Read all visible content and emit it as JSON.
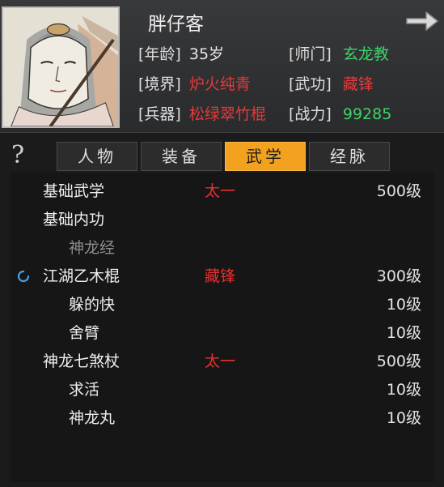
{
  "character": {
    "name": "胖仔客",
    "fields": {
      "age": {
        "label": "[年龄]",
        "value": "35岁",
        "color": "#e6e6e6"
      },
      "sect": {
        "label": "[师门]",
        "value": "玄龙教",
        "color": "#3fd36a"
      },
      "realm": {
        "label": "[境界]",
        "value": "炉火纯青",
        "color": "#e33a3a"
      },
      "martial": {
        "label": "[武功]",
        "value": "藏锋",
        "color": "#e33a3a"
      },
      "weapon": {
        "label": "[兵器]",
        "value": "松绿翠竹棍",
        "color": "#e33a3a"
      },
      "power": {
        "label": "[战力]",
        "value": "99285",
        "color": "#3fd36a"
      }
    }
  },
  "tabs": [
    {
      "label": "人物",
      "active": false
    },
    {
      "label": "装备",
      "active": false
    },
    {
      "label": "武学",
      "active": true
    },
    {
      "label": "经脉",
      "active": false
    }
  ],
  "help_glyph": "?",
  "skills": [
    {
      "name": "基础武学",
      "school": "太一",
      "level": "500级",
      "indent": 0
    },
    {
      "name": "基础内功",
      "school": "",
      "level": "",
      "indent": 0
    },
    {
      "name": "神龙经",
      "school": "",
      "level": "",
      "indent": 1,
      "dim": true
    },
    {
      "name": "江湖乙木棍",
      "school": "藏锋",
      "level": "300级",
      "indent": 0,
      "spinner": true
    },
    {
      "name": "躲的快",
      "school": "",
      "level": "10级",
      "indent": 1
    },
    {
      "name": "舍臂",
      "school": "",
      "level": "10级",
      "indent": 1
    },
    {
      "name": "神龙七煞杖",
      "school": "太一",
      "level": "500级",
      "indent": 0
    },
    {
      "name": "求活",
      "school": "",
      "level": "10级",
      "indent": 1
    },
    {
      "name": "神龙丸",
      "school": "",
      "level": "10级",
      "indent": 1
    }
  ],
  "icons": {
    "arrow": "right-arrow-icon",
    "help": "question-mark-icon",
    "loading": "loading-spinner-icon"
  },
  "colors": {
    "active_tab": "#f2a21e",
    "school_text": "#e5312f",
    "green_value": "#3fd36a"
  }
}
